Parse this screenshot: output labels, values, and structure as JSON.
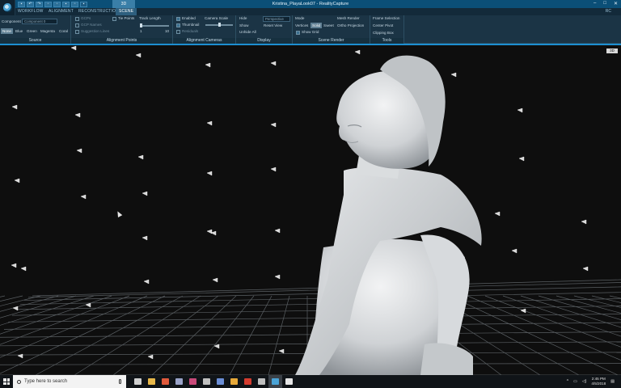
{
  "titlebar": {
    "app_title": "Kristina_PlayaLook07 - RealityCapture",
    "active_context_tab": "3D",
    "quick_access": [
      "save",
      "undo",
      "redo",
      "copy",
      "paste",
      "settings",
      "workflow",
      "view"
    ]
  },
  "ribbon_tabs": [
    {
      "label": "WORKFLOW",
      "active": false
    },
    {
      "label": "ALIGNMENT",
      "active": false
    },
    {
      "label": "RECONSTRUCTION",
      "active": false
    },
    {
      "label": "SCENE",
      "active": true
    }
  ],
  "rc_label": "RC",
  "ribbon": {
    "source": {
      "caption": "Source",
      "component_label": "Component",
      "component_value": "Component 0",
      "buttons": [
        "None",
        "Blue",
        "Green",
        "Magenta",
        "Coral"
      ]
    },
    "alignment_points": {
      "caption": "Alignment Points",
      "items": [
        "GCPs",
        "GCP Names",
        "Suggestion Lines"
      ],
      "tie_points": "Tie Points",
      "track_length": "Track Length",
      "range_min": "1",
      "range_max": "10"
    },
    "alignment_cameras": {
      "caption": "Alignment Cameras",
      "items": [
        "Enabled",
        "Thumbnail",
        "Residuals"
      ],
      "camera_scale": "Camera Scale"
    },
    "display": {
      "caption": "Display",
      "items": [
        "Hide",
        "Show",
        "Unhide All"
      ],
      "projection": "Perspective",
      "reset_view": "Reset View"
    },
    "scene_render": {
      "caption": "Scene Render",
      "mode_label": "Mode",
      "modes": [
        "Vertices",
        "Solid",
        "Sweet"
      ],
      "active_mode": "Solid",
      "show_grid": "Show Grid",
      "mesh_render": "Mesh Render",
      "ortho_projection": "Ortho Projection"
    },
    "tools": {
      "caption": "Tools",
      "items": [
        "Frame Selection",
        "Center Pivot",
        "Clipping Box"
      ]
    }
  },
  "viewport": {
    "badge": "3D",
    "grid_color": "#5a5f63",
    "background": "#0e0e0e",
    "model_color": "#d9dcdf"
  },
  "taskbar": {
    "search_placeholder": "Type here to search",
    "time": "2:45 PM",
    "date": "4/5/2018",
    "apps": [
      {
        "name": "task-view",
        "color": "#d0d0d0"
      },
      {
        "name": "file-explorer",
        "color": "#e8b84a"
      },
      {
        "name": "chrome",
        "color": "#e05a3c"
      },
      {
        "name": "app-a",
        "color": "#9aa3c8"
      },
      {
        "name": "app-b",
        "color": "#c94a7a"
      },
      {
        "name": "app-c",
        "color": "#c0c0c0"
      },
      {
        "name": "app-d",
        "color": "#6b8ed6"
      },
      {
        "name": "app-e",
        "color": "#e7a93a"
      },
      {
        "name": "app-f",
        "color": "#d43c2f"
      },
      {
        "name": "app-g",
        "color": "#bfbfbf"
      },
      {
        "name": "realitycapture",
        "color": "#4aa3d6"
      },
      {
        "name": "app-h",
        "color": "#e6e6e6"
      }
    ]
  }
}
